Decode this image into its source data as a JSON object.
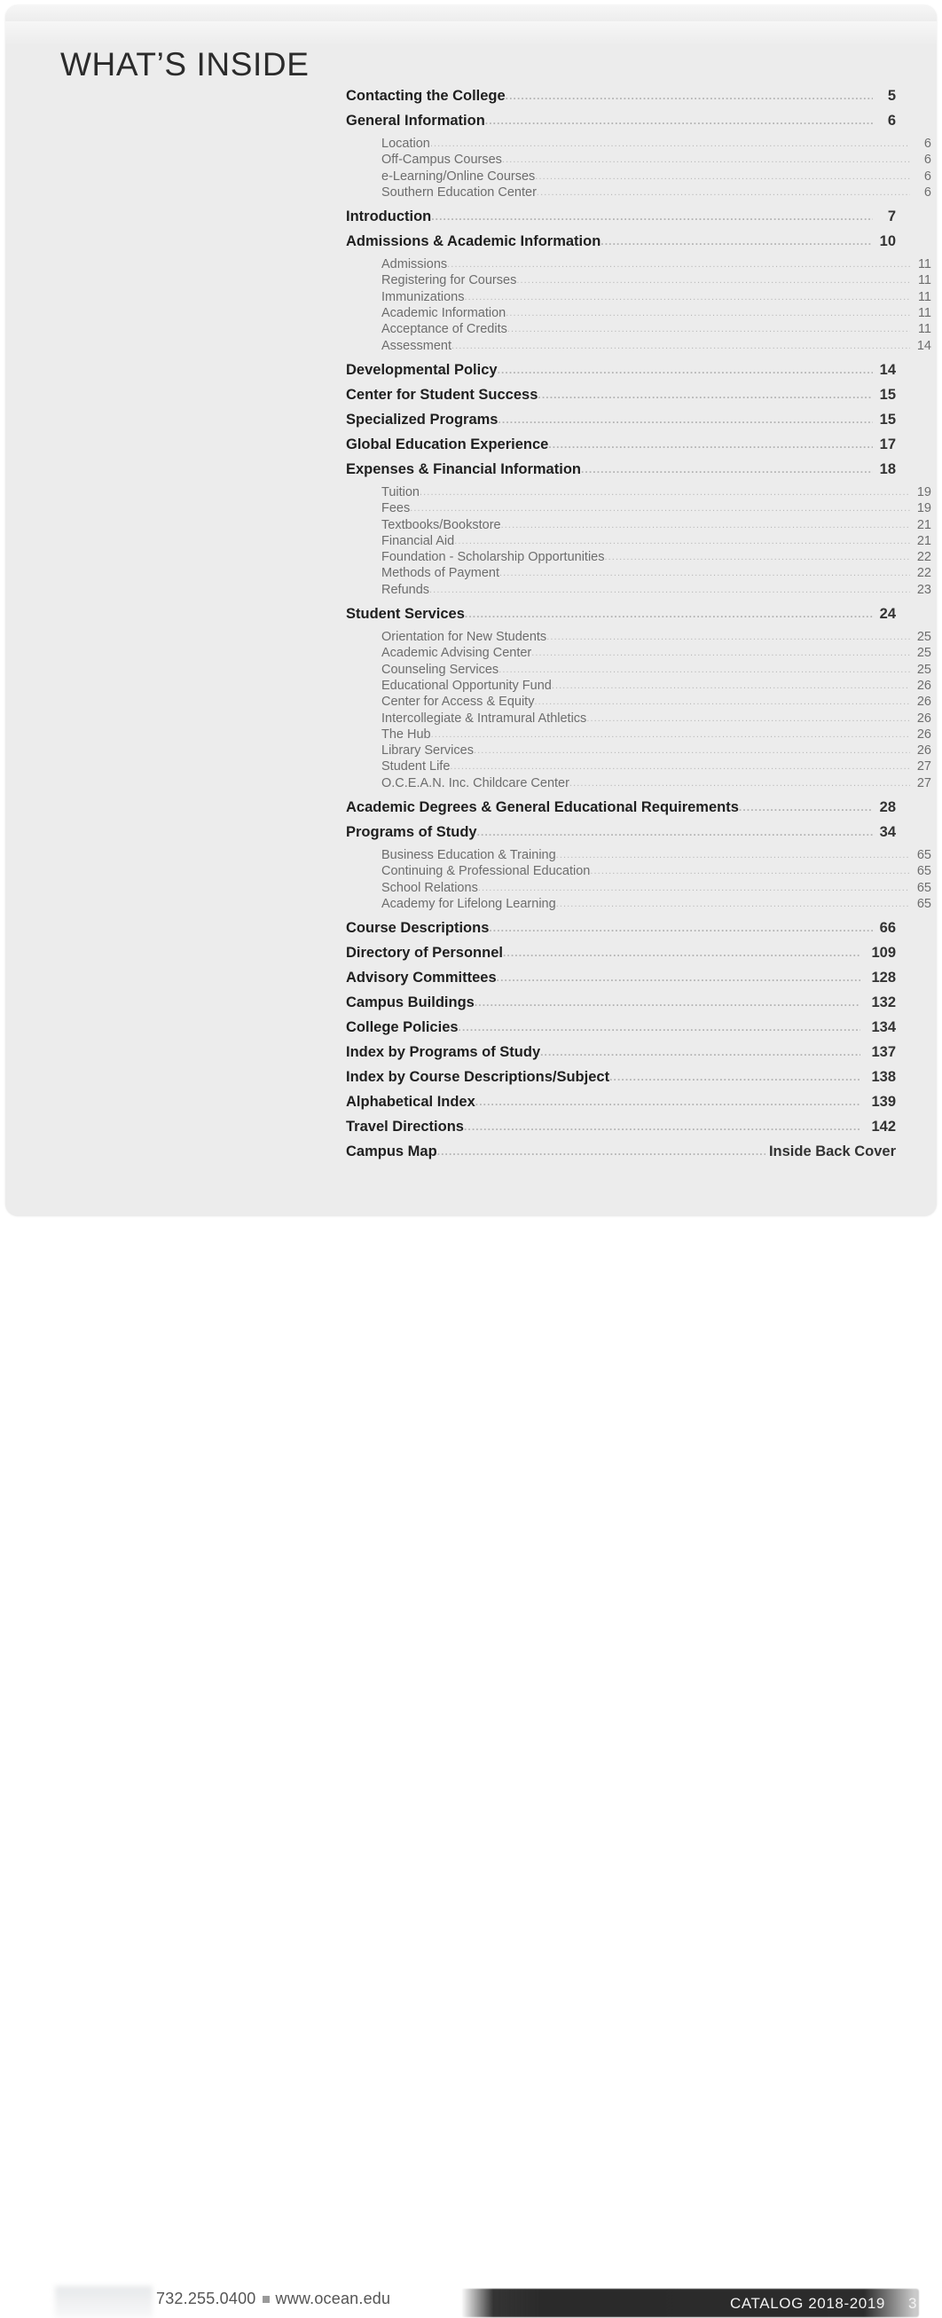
{
  "page": {
    "heading": "WHAT’S INSIDE"
  },
  "toc": {
    "entries": [
      {
        "level": "major",
        "label": "Contacting the College",
        "page": "5"
      },
      {
        "level": "major",
        "label": "General Information",
        "page": "6"
      },
      {
        "level": "sub",
        "label": "Location",
        "page": "6"
      },
      {
        "level": "sub",
        "label": "Off-Campus Courses",
        "page": "6"
      },
      {
        "level": "sub",
        "label": "e-Learning/Online Courses",
        "page": "6"
      },
      {
        "level": "sub",
        "label": "Southern Education Center",
        "page": "6"
      },
      {
        "level": "major",
        "label": "Introduction",
        "page": "7"
      },
      {
        "level": "major",
        "label": "Admissions & Academic Information",
        "page": "10"
      },
      {
        "level": "sub",
        "label": "Admissions",
        "page": "11"
      },
      {
        "level": "sub",
        "label": "Registering for Courses",
        "page": "11"
      },
      {
        "level": "sub",
        "label": "Immunizations",
        "page": "11"
      },
      {
        "level": "sub",
        "label": "Academic Information",
        "page": "11"
      },
      {
        "level": "sub",
        "label": "Acceptance of Credits",
        "page": "11"
      },
      {
        "level": "sub",
        "label": "Assessment",
        "page": "14"
      },
      {
        "level": "major",
        "label": "Developmental Policy",
        "page": "14"
      },
      {
        "level": "major",
        "label": "Center for Student Success",
        "page": "15"
      },
      {
        "level": "major",
        "label": "Specialized Programs",
        "page": "15"
      },
      {
        "level": "major",
        "label": "Global Education Experience",
        "page": "17"
      },
      {
        "level": "major",
        "label": "Expenses & Financial Information",
        "page": "18"
      },
      {
        "level": "sub",
        "label": "Tuition",
        "page": "19"
      },
      {
        "level": "sub",
        "label": "Fees",
        "page": "19"
      },
      {
        "level": "sub",
        "label": "Textbooks/Bookstore",
        "page": "21"
      },
      {
        "level": "sub",
        "label": "Financial Aid",
        "page": "21"
      },
      {
        "level": "sub",
        "label": "Foundation - Scholarship Opportunities",
        "page": "22"
      },
      {
        "level": "sub",
        "label": "Methods of Payment",
        "page": "22"
      },
      {
        "level": "sub",
        "label": "Refunds",
        "page": "23"
      },
      {
        "level": "major",
        "label": "Student Services",
        "page": "24"
      },
      {
        "level": "sub",
        "label": "Orientation for New Students",
        "page": "25"
      },
      {
        "level": "sub",
        "label": "Academic Advising Center",
        "page": "25"
      },
      {
        "level": "sub",
        "label": "Counseling Services",
        "page": "25"
      },
      {
        "level": "sub",
        "label": "Educational Opportunity Fund",
        "page": "26"
      },
      {
        "level": "sub",
        "label": "Center for Access & Equity",
        "page": "26"
      },
      {
        "level": "sub",
        "label": "Intercollegiate & Intramural Athletics",
        "page": "26"
      },
      {
        "level": "sub",
        "label": "The Hub",
        "page": "26"
      },
      {
        "level": "sub",
        "label": "Library Services",
        "page": "26"
      },
      {
        "level": "sub",
        "label": "Student Life",
        "page": "27"
      },
      {
        "level": "sub",
        "label": "O.C.E.A.N. Inc. Childcare Center",
        "page": "27"
      },
      {
        "level": "major",
        "label": "Academic Degrees & General Educational Requirements",
        "page": "28"
      },
      {
        "level": "major",
        "label": "Programs of Study",
        "page": "34"
      },
      {
        "level": "sub",
        "label": "Business Education & Training",
        "page": "65"
      },
      {
        "level": "sub",
        "label": "Continuing & Professional Education",
        "page": "65"
      },
      {
        "level": "sub",
        "label": "School Relations",
        "page": "65"
      },
      {
        "level": "sub",
        "label": "Academy for Lifelong Learning",
        "page": "65"
      },
      {
        "level": "major",
        "label": "Course Descriptions",
        "page": "66"
      },
      {
        "level": "major",
        "label": "Directory of Personnel",
        "page": "109"
      },
      {
        "level": "major",
        "label": "Advisory Committees",
        "page": "128"
      },
      {
        "level": "major",
        "label": "Campus Buildings",
        "page": "132"
      },
      {
        "level": "major",
        "label": "College Policies",
        "page": "134"
      },
      {
        "level": "major",
        "label": "Index by Programs of Study",
        "page": "137"
      },
      {
        "level": "major",
        "label": "Index by Course Descriptions/Subject",
        "page": "138"
      },
      {
        "level": "major",
        "label": "Alphabetical Index",
        "page": "139"
      },
      {
        "level": "major",
        "label": "Travel Directions",
        "page": "142"
      },
      {
        "level": "major",
        "label": "Campus Map",
        "page": "Inside Back Cover"
      }
    ]
  },
  "footer": {
    "phone": "732.255.0400",
    "website": "www.ocean.edu",
    "catalog_label": "CATALOG  2018-2019",
    "page_number": "3"
  }
}
